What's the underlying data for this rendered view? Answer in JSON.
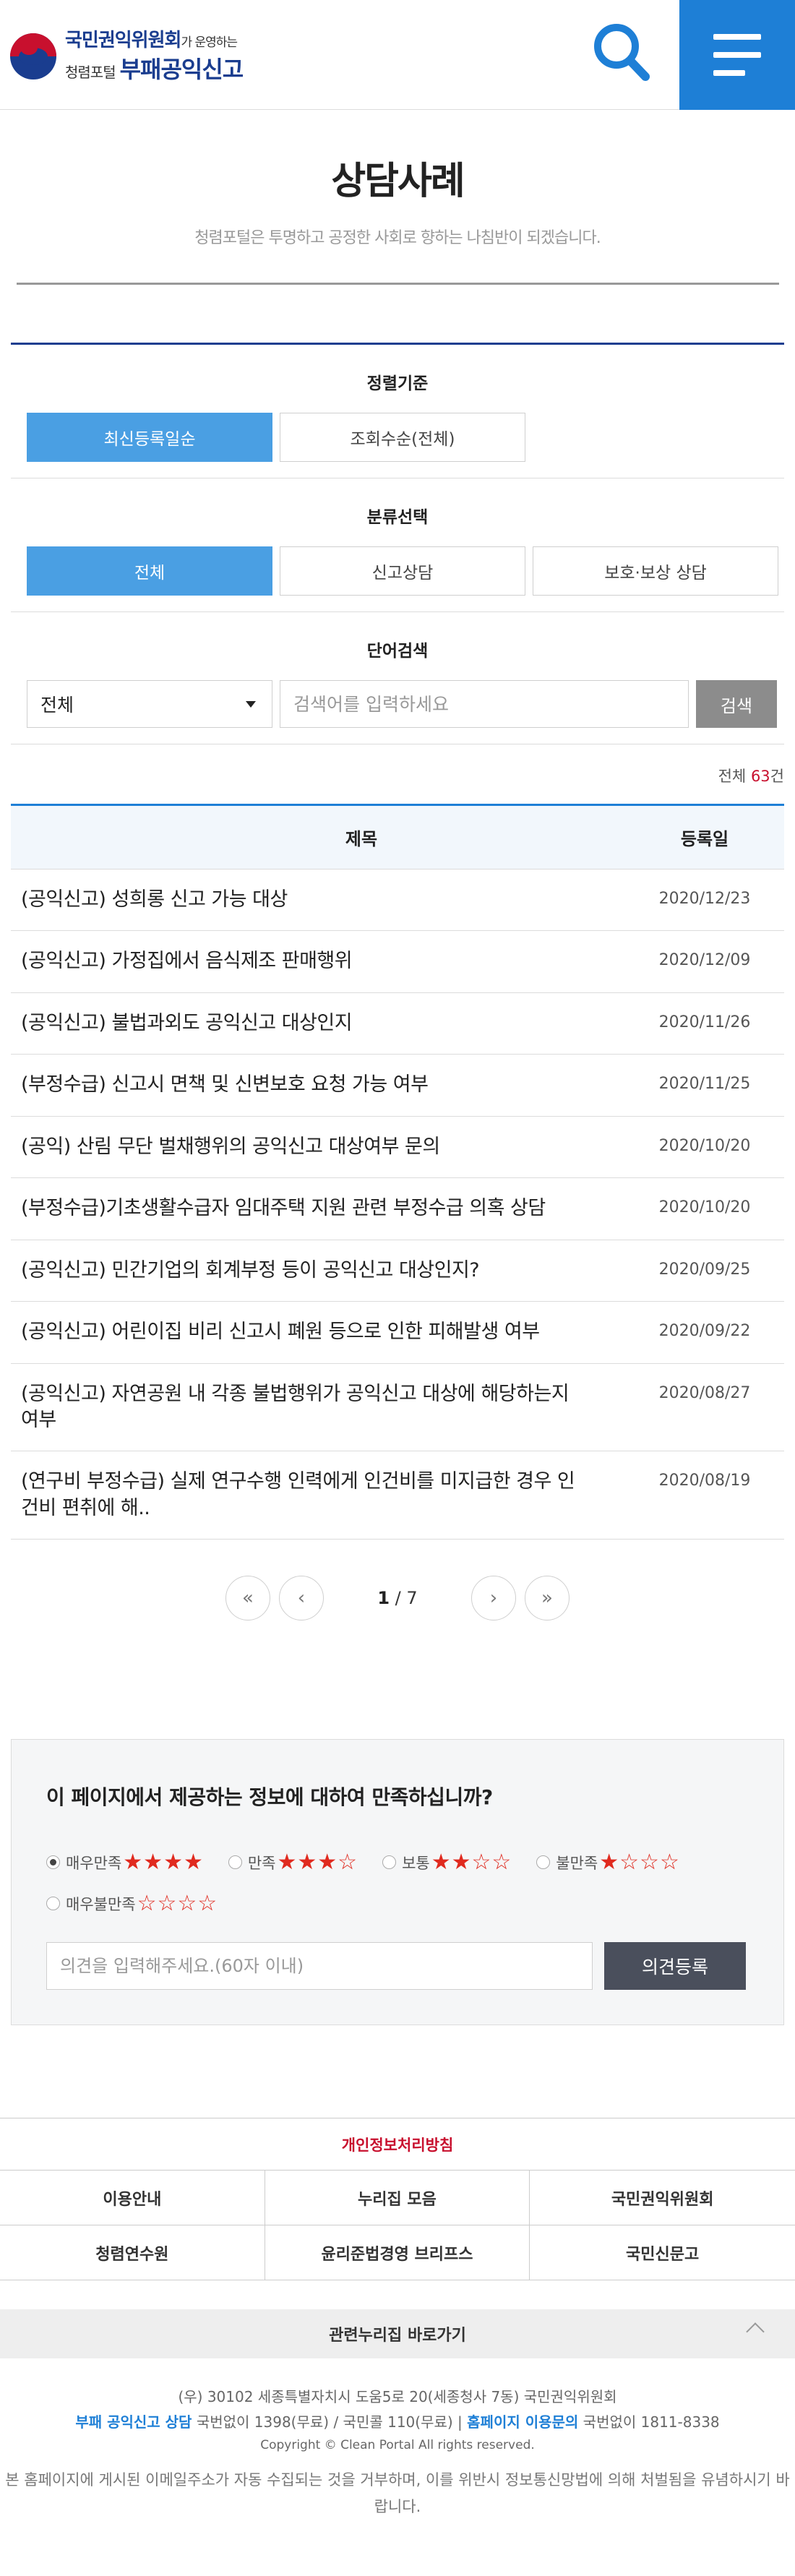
{
  "header": {
    "org_name": "국민권익위원회",
    "org_suffix": "가 운영하는",
    "portal_prefix": "청렴포털",
    "portal_name": "부패공익신고"
  },
  "page": {
    "title": "상담사례",
    "subtitle": "청렴포털은 투명하고 공정한 사회로 향하는 나침반이 되겠습니다."
  },
  "filters": {
    "sort_heading": "정렬기준",
    "sort_options": [
      "최신등록일순",
      "조회수순(전체)"
    ],
    "category_heading": "분류선택",
    "category_options": [
      "전체",
      "신고상담",
      "보호·보상 상담"
    ],
    "search_heading": "단어검색",
    "search_select_value": "전체",
    "search_placeholder": "검색어를 입력하세요",
    "search_button": "검색"
  },
  "total": {
    "label": "전체",
    "count": "63",
    "unit": "건"
  },
  "table": {
    "col_title": "제목",
    "col_date": "등록일",
    "rows": [
      {
        "title": "(공익신고) 성희롱 신고 가능 대상",
        "date": "2020/12/23"
      },
      {
        "title": "(공익신고) 가정집에서 음식제조 판매행위",
        "date": "2020/12/09"
      },
      {
        "title": "(공익신고) 불법과외도 공익신고 대상인지",
        "date": "2020/11/26"
      },
      {
        "title": "(부정수급) 신고시 면책 및 신변보호 요청 가능 여부",
        "date": "2020/11/25"
      },
      {
        "title": "(공익) 산림 무단 벌채행위의 공익신고 대상여부 문의",
        "date": "2020/10/20"
      },
      {
        "title": "(부정수급)기초생활수급자 임대주택 지원 관련 부정수급 의혹 상담",
        "date": "2020/10/20"
      },
      {
        "title": "(공익신고) 민간기업의 회계부정 등이 공익신고 대상인지?",
        "date": "2020/09/25"
      },
      {
        "title": "(공익신고) 어린이집 비리 신고시 폐원 등으로 인한 피해발생 여부",
        "date": "2020/09/22"
      },
      {
        "title": "(공익신고) 자연공원 내 각종 불법행위가 공익신고 대상에 해당하는지 여부",
        "date": "2020/08/27"
      },
      {
        "title": "(연구비 부정수급) 실제 연구수행 인력에게 인건비를 미지급한 경우 인건비 편취에 해..",
        "date": "2020/08/19"
      }
    ]
  },
  "pagination": {
    "current": "1",
    "separator": " / ",
    "total": "7"
  },
  "survey": {
    "question": "이 페이지에서 제공하는 정보에 대하여 만족하십니까?",
    "options": [
      {
        "label": "매우만족",
        "stars": "★★★★",
        "checked": true
      },
      {
        "label": "만족",
        "stars": "★★★☆",
        "checked": false
      },
      {
        "label": "보통",
        "stars": "★★☆☆",
        "checked": false
      },
      {
        "label": "불만족",
        "stars": "★☆☆☆",
        "checked": false
      },
      {
        "label": "매우불만족",
        "stars": "☆☆☆☆",
        "checked": false
      }
    ],
    "opinion_placeholder": "의견을 입력해주세요.(60자 이내)",
    "submit": "의견등록"
  },
  "footer": {
    "privacy": "개인정보처리방침",
    "links": [
      "이용안내",
      "누리집 모음",
      "국민권익위원회",
      "청렴연수원",
      "윤리준법경영 브리프스",
      "국민신문고"
    ],
    "related": "관련누리집 바로가기",
    "address": "(우) 30102 세종특별자치시 도움5로 20(세종청사 7동) 국민권익위원회",
    "consult_label": "부패 공익신고 상담",
    "consult_text": "국번없이 1398(무료) / 국민콜 110(무료)",
    "inquiry_label": "홈페이지 이용문의",
    "inquiry_text": "국번없이 1811-8338",
    "copyright": "Copyright © Clean Portal All rights reserved.",
    "warning": "본 홈페이지에 게시된 이메일주소가 자동 수집되는 것을 거부하며, 이를 위반시 정보통신망법에 의해 처벌됨을 유념하시기 바랍니다."
  },
  "colors": {
    "brand_blue": "#1a3d8f",
    "accent_blue": "#1e7fd6",
    "active_button": "#4a9fe3",
    "count_red": "#c8102e",
    "star_red": "#e02a1f"
  }
}
